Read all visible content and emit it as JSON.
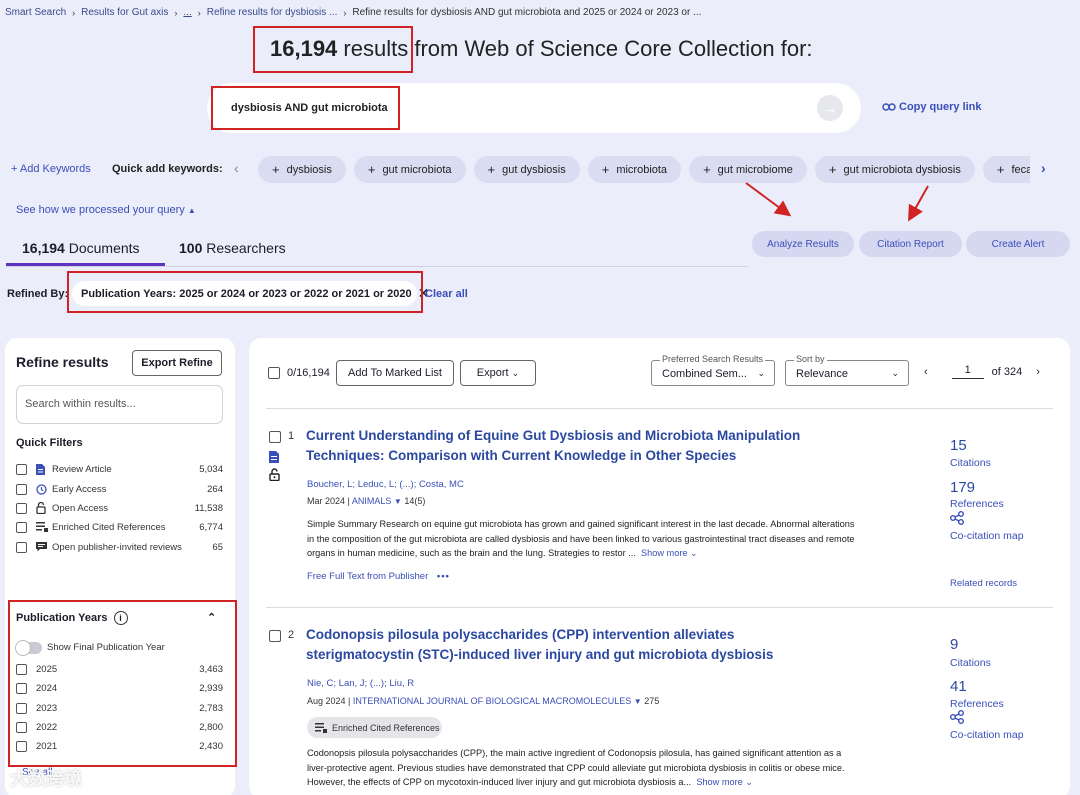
{
  "breadcrumb": {
    "items": [
      "Smart Search",
      "Results for Gut axis",
      "...",
      "Refine results for dysbiosis ...",
      "Refine results for dysbiosis AND gut microbiota and 2025 or 2024 or 2023 or ..."
    ]
  },
  "header": {
    "count": "16,194",
    "suffix": "results from Web of Science Core Collection for:"
  },
  "search": {
    "query": "dysbiosis AND gut microbiota",
    "copy_label": "Copy query link"
  },
  "keywords": {
    "add_label": "+ Add Keywords",
    "quick_label": "Quick add keywords:",
    "chips": [
      "dysbiosis",
      "gut microbiota",
      "gut dysbiosis",
      "microbiota",
      "gut microbiome",
      "gut microbiota dysbiosis",
      "fecal"
    ]
  },
  "see_how": "See how we processed your query",
  "tabs": {
    "documents_count": "16,194",
    "documents_label": "Documents",
    "researchers_count": "100",
    "researchers_label": "Researchers"
  },
  "actions": {
    "analyze": "Analyze Results",
    "citation": "Citation Report",
    "alert": "Create Alert"
  },
  "refined": {
    "label": "Refined By:",
    "chip": "Publication Years: 2025 or 2024 or 2023 or 2022 or 2021 or 2020",
    "clear": "Clear all"
  },
  "refine_panel": {
    "title": "Refine results",
    "export_label": "Export Refine",
    "search_placeholder": "Search within results...",
    "quick_filters_title": "Quick Filters",
    "quick_filters": [
      {
        "label": "Review Article",
        "count": "5,034",
        "icon": "document-icon"
      },
      {
        "label": "Early Access",
        "count": "264",
        "icon": "clock-icon"
      },
      {
        "label": "Open Access",
        "count": "11,538",
        "icon": "lock-open-icon"
      },
      {
        "label": "Enriched Cited References",
        "count": "6,774",
        "icon": "list-icon"
      },
      {
        "label": "Open publisher-invited reviews",
        "count": "65",
        "icon": "comment-icon"
      }
    ],
    "pub_years_title": "Publication Years",
    "show_final": "Show Final Publication Year",
    "years": [
      {
        "label": "2025",
        "count": "3,463"
      },
      {
        "label": "2024",
        "count": "2,939"
      },
      {
        "label": "2023",
        "count": "2,783"
      },
      {
        "label": "2022",
        "count": "2,800"
      },
      {
        "label": "2021",
        "count": "2,430"
      }
    ],
    "see_all": "See all"
  },
  "toolbar": {
    "selected": "0/16,194",
    "add_marked": "Add To Marked List",
    "export": "Export",
    "preferred_label": "Preferred Search Results",
    "preferred_value": "Combined Sem...",
    "sort_label": "Sort by",
    "sort_value": "Relevance",
    "page": "1",
    "of_pages": "of 324"
  },
  "records": [
    {
      "num": "1",
      "title": "Current Understanding of Equine Gut Dysbiosis and Microbiota Manipulation Techniques: Comparison with Current Knowledge in Other Species",
      "authors": "Boucher, L; Leduc, L; (...); Costa, MC",
      "date": "Mar 2024",
      "journal": "ANIMALS",
      "issue": "14(5)",
      "abstract": "Simple Summary Research on equine gut microbiota has grown and gained significant interest in the last decade. Abnormal alterations in the composition of the gut microbiota are called dysbiosis and have been linked to various gastrointestinal tract diseases and remote organs in human medicine, such as the brain and the lung. Strategies to restor ...",
      "show_more": "Show more",
      "full_text": "Free Full Text from Publisher",
      "citations": "15",
      "citations_label": "Citations",
      "references": "179",
      "references_label": "References",
      "cocitation": "Co-citation map",
      "related": "Related records"
    },
    {
      "num": "2",
      "title": "Codonopsis pilosula polysaccharides (CPP) intervention alleviates sterigmatocystin (STC)-induced liver injury and gut microbiota dysbiosis",
      "authors": "Nie, C; Lan, J; (...); Liu, R",
      "date": "Aug 2024",
      "journal": "INTERNATIONAL JOURNAL OF BIOLOGICAL MACROMOLECULES",
      "issue": "275",
      "enriched": "Enriched Cited References",
      "abstract": "Codonopsis pilosula polysaccharides (CPP), the main active ingredient of Codonopsis pilosula, has gained significant attention as a liver-protective agent. Previous studies have demonstrated that CPP could alleviate gut microbiota dysbiosis in colitis or obese mice. However, the effects of CPP on mycotoxin-induced liver injury and gut microbiota dysbiosis a...",
      "show_more": "Show more",
      "citations": "9",
      "citations_label": "Citations",
      "references": "41",
      "references_label": "References",
      "cocitation": "Co-citation map"
    }
  ],
  "watermark": "大数跨境",
  "colors": {
    "background": "#ebedfa",
    "link": "#3a4fb8",
    "title": "#2b48a0",
    "highlight": "#d02424",
    "tab_accent": "#5e33bf"
  }
}
